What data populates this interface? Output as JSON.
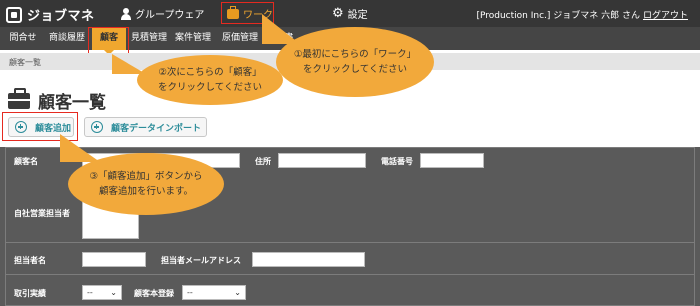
{
  "header": {
    "app_name": "ジョブマネ",
    "nav": [
      {
        "label": "グループウェア",
        "icon": "person-icon"
      },
      {
        "label": "ワーク",
        "icon": "briefcase-icon"
      },
      {
        "label": "設定",
        "icon": "gear-icon"
      }
    ],
    "user_info": "[Production Inc.] ジョブマネ 六郎 さん",
    "logout": "ログアウト"
  },
  "menu": {
    "items": [
      "問合せ",
      "商談履歴",
      "顧客",
      "見積管理",
      "案件管理",
      "原価管理",
      "請求書"
    ],
    "active": "顧客"
  },
  "breadcrumb": "顧客一覧",
  "page_title": "顧客一覧",
  "actions": {
    "add_customer": "顧客追加",
    "import_customer": "顧客データインポート"
  },
  "form": {
    "customer_name": "顧客名",
    "address": "住所",
    "phone": "電話番号",
    "sales_rep": "自社営業担当者",
    "contact_name": "担当者名",
    "contact_email": "担当者メールアドレス",
    "transaction": "取引実績",
    "transaction_value": "--",
    "registered": "顧客本登録",
    "registered_value": "--"
  },
  "callouts": {
    "step1": "①最初にこちらの「ワーク」\nをクリックしてください",
    "step2": "②次にこちらの「顧客」\nをクリックしてください",
    "step3": "③「顧客追加」ボタンから\n顧客追加を行います。"
  },
  "colors": {
    "topbar": "#363636",
    "menubar": "#454545",
    "accent": "#f0a72f",
    "callout": "#f2a93b",
    "highlight_frame": "#e52a20",
    "form_bg": "#5a5a5a",
    "button_text": "#2d8d9a"
  }
}
